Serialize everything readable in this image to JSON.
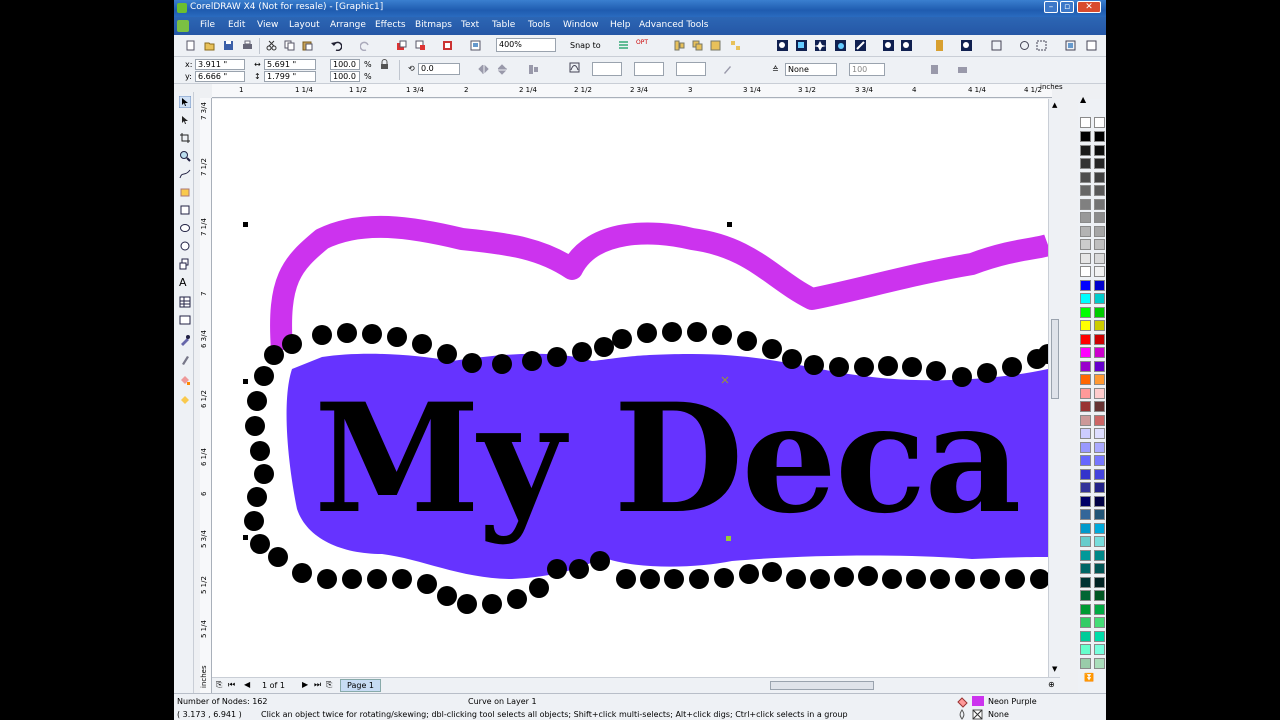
{
  "window": {
    "title": "CorelDRAW X4 (Not for resale) - [Graphic1]"
  },
  "menu": {
    "items": [
      "File",
      "Edit",
      "View",
      "Layout",
      "Arrange",
      "Effects",
      "Bitmaps",
      "Text",
      "Table",
      "Tools",
      "Window",
      "Help",
      "Advanced Tools"
    ]
  },
  "standard_toolbar": {
    "zoom": "400%",
    "snap_to": "Snap to"
  },
  "property_bar": {
    "x": "3.911 \"",
    "y": "6.666 \"",
    "width": "5.691 \"",
    "height": "1.799 \"",
    "x_label": "x:",
    "y_label": "y:",
    "scale_w": "100.0",
    "scale_h": "100.0",
    "percent": "%",
    "rotation": "0.0",
    "outline": "None",
    "opacity": "100"
  },
  "ruler": {
    "unit": "inches",
    "h_labels": [
      "1",
      "1 1/4",
      "1 1/2",
      "1 3/4",
      "2",
      "2 1/4",
      "2 1/2",
      "2 3/4",
      "3",
      "3 1/4",
      "3 1/2",
      "3 3/4",
      "4",
      "4 1/4",
      "4 1/2",
      "4 3/4"
    ],
    "v_labels": [
      "7 3/4",
      "7 1/2",
      "7 1/4",
      "7",
      "6 3/4",
      "6 1/2",
      "6 1/4",
      "6",
      "5 3/4",
      "5 1/2",
      "5 1/4"
    ],
    "v_unit": "inches"
  },
  "artwork": {
    "text": "My Deca",
    "outer_color": "#cc33ee",
    "inner_color": "#6633ff",
    "dot_color": "#000000"
  },
  "page_nav": {
    "count": "1 of 1",
    "tab": "Page 1"
  },
  "status": {
    "nodes": "Number of Nodes: 162",
    "object": "Curve on Layer 1",
    "fill_name": "Neon Purple",
    "outline_name": "None",
    "coords": "( 3.173 , 6.941 )",
    "hint": "Click an object twice for rotating/skewing; dbl-clicking tool selects all objects; Shift+click multi-selects; Alt+click digs; Ctrl+click selects in a group"
  },
  "palette": {
    "col1": [
      "#000000",
      "#1a1a1a",
      "#333333",
      "#4d4d4d",
      "#666666",
      "#808080",
      "#999999",
      "#b3b3b3",
      "#cccccc",
      "#e6e6e6",
      "#ffffff",
      "#0000ff",
      "#00ffff",
      "#00ff00",
      "#ffff00",
      "#ff0000",
      "#ff00ff",
      "#9900cc",
      "#ff6600",
      "#ff9999",
      "#993333",
      "#cc9999",
      "#ccccff",
      "#9999ff",
      "#6666ff",
      "#3333cc",
      "#333399",
      "#000066",
      "#336699",
      "#0099cc",
      "#66cccc",
      "#009999",
      "#006666",
      "#003333",
      "#006633",
      "#009933",
      "#33cc66",
      "#00cc99",
      "#66ffcc",
      "#99ccaa"
    ],
    "col2": [
      "#000000",
      "#0d0d0d",
      "#262626",
      "#404040",
      "#595959",
      "#737373",
      "#8c8c8c",
      "#a6a6a6",
      "#bfbfbf",
      "#d9d9d9",
      "#f2f2f2",
      "#0000cc",
      "#00cccc",
      "#00cc00",
      "#cccc00",
      "#cc0000",
      "#cc00cc",
      "#6600cc",
      "#ff9933",
      "#ffcccc",
      "#663333",
      "#cc6666",
      "#ddddff",
      "#aaaaff",
      "#7777ff",
      "#4444dd",
      "#222288",
      "#000044",
      "#225577",
      "#00aadd",
      "#77dddd",
      "#008888",
      "#005555",
      "#002222",
      "#005522",
      "#00aa44",
      "#44dd77",
      "#00ddaa",
      "#77ffdd",
      "#aaddbb"
    ]
  }
}
